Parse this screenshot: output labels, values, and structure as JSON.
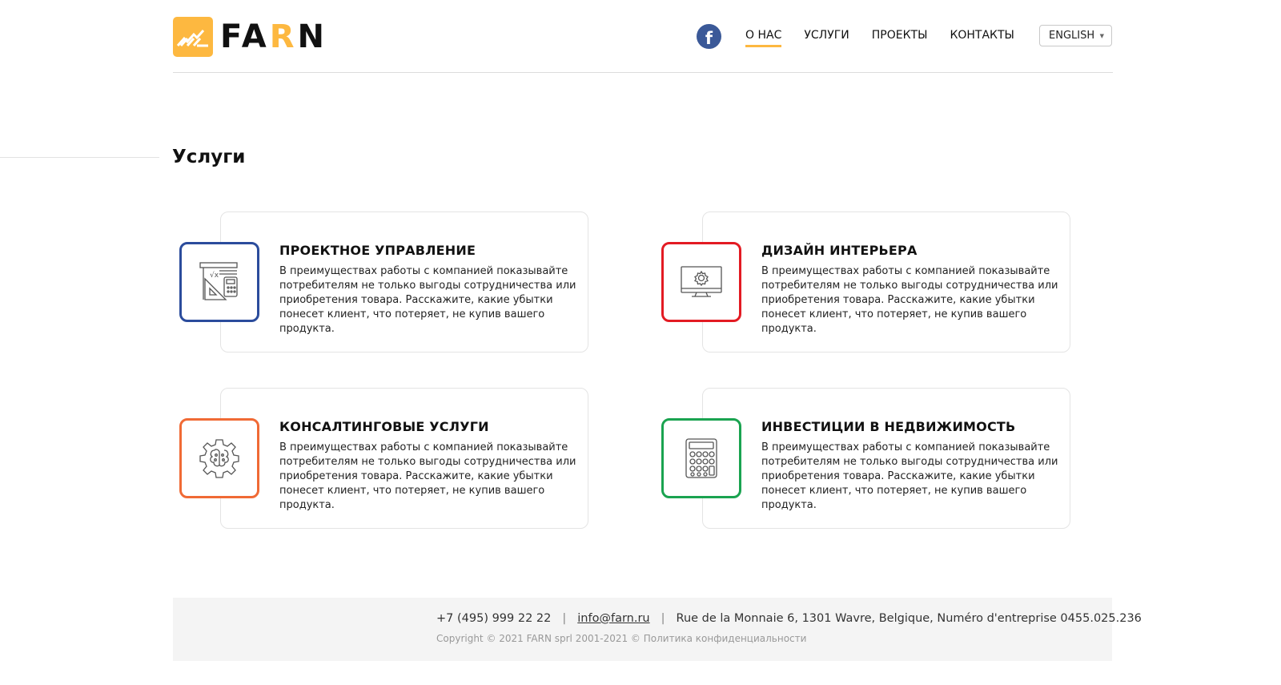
{
  "header": {
    "logo_text_before": "FA",
    "logo_text_accent": "R",
    "logo_text_after": "N",
    "facebook_glyph": "f",
    "nav": [
      {
        "label": "О НАС",
        "active": true
      },
      {
        "label": "УСЛУГИ",
        "active": false
      },
      {
        "label": "ПРОЕКТЫ",
        "active": false
      },
      {
        "label": "КОНТАКТЫ",
        "active": false
      }
    ],
    "language": "ENGLISH"
  },
  "section_title": "Услуги",
  "services": [
    {
      "title": "ПРОЕКТНОЕ УПРАВЛЕНИЕ",
      "description": "В преимуществах работы с компанией показывайте потребителям не только выгоды сотрудничества или приобретения товара. Расскажите, какие убытки понесет клиент, что потеряет, не купив вашего продукта.",
      "icon": "drafting-tools-icon",
      "color": "#2b4c9c"
    },
    {
      "title": "ДИЗАЙН ИНТЕРЬЕРА",
      "description": "В преимуществах работы с компанией показывайте потребителям не только выгоды сотрудничества или приобретения товара. Расскажите, какие убытки понесет клиент, что потеряет, не купив вашего продукта.",
      "icon": "monitor-gear-icon",
      "color": "#e31b23"
    },
    {
      "title": "КОНСАЛТИНГОВЫЕ УСЛУГИ",
      "description": "В преимуществах работы с компанией показывайте потребителям не только выгоды сотрудничества или приобретения товара. Расскажите, какие убытки понесет клиент, что потеряет, не купив вашего продукта.",
      "icon": "gear-brain-icon",
      "color": "#f06a35"
    },
    {
      "title": "ИНВЕСТИЦИИ В НЕДВИЖИМОСТЬ",
      "description": "В преимуществах работы с компанией показывайте потребителям не только выгоды сотрудничества или приобретения товара. Расскажите, какие убытки понесет клиент, что потеряет, не купив вашего продукта.",
      "icon": "calculator-icon",
      "color": "#1aa350"
    }
  ],
  "footer": {
    "phone": "+7 (495) 999 22 22",
    "separator": "|",
    "email": "info@farn.ru",
    "address": "Rue de la Monnaie 6, 1301 Wavre, Belgique, Numéro d'entreprise  0455.025.236",
    "copyright": "Copyright © 2021 FARN sprl  2001-2021 © ",
    "privacy": "Политика конфиденциальности"
  },
  "colors": {
    "accent": "#fdb840",
    "facebook": "#3b5998"
  }
}
